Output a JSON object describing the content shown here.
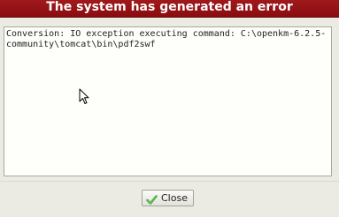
{
  "dialog": {
    "title": "The system has generated an error",
    "message": "Conversion: IO exception executing command: C:\\openkm-6.2.5-community\\tomcat\\bin\\pdf2swf",
    "close_label": "Close",
    "close_icon": "check-icon",
    "colors": {
      "titlebar": "#a0191c",
      "check": "#2f9a2a"
    }
  }
}
